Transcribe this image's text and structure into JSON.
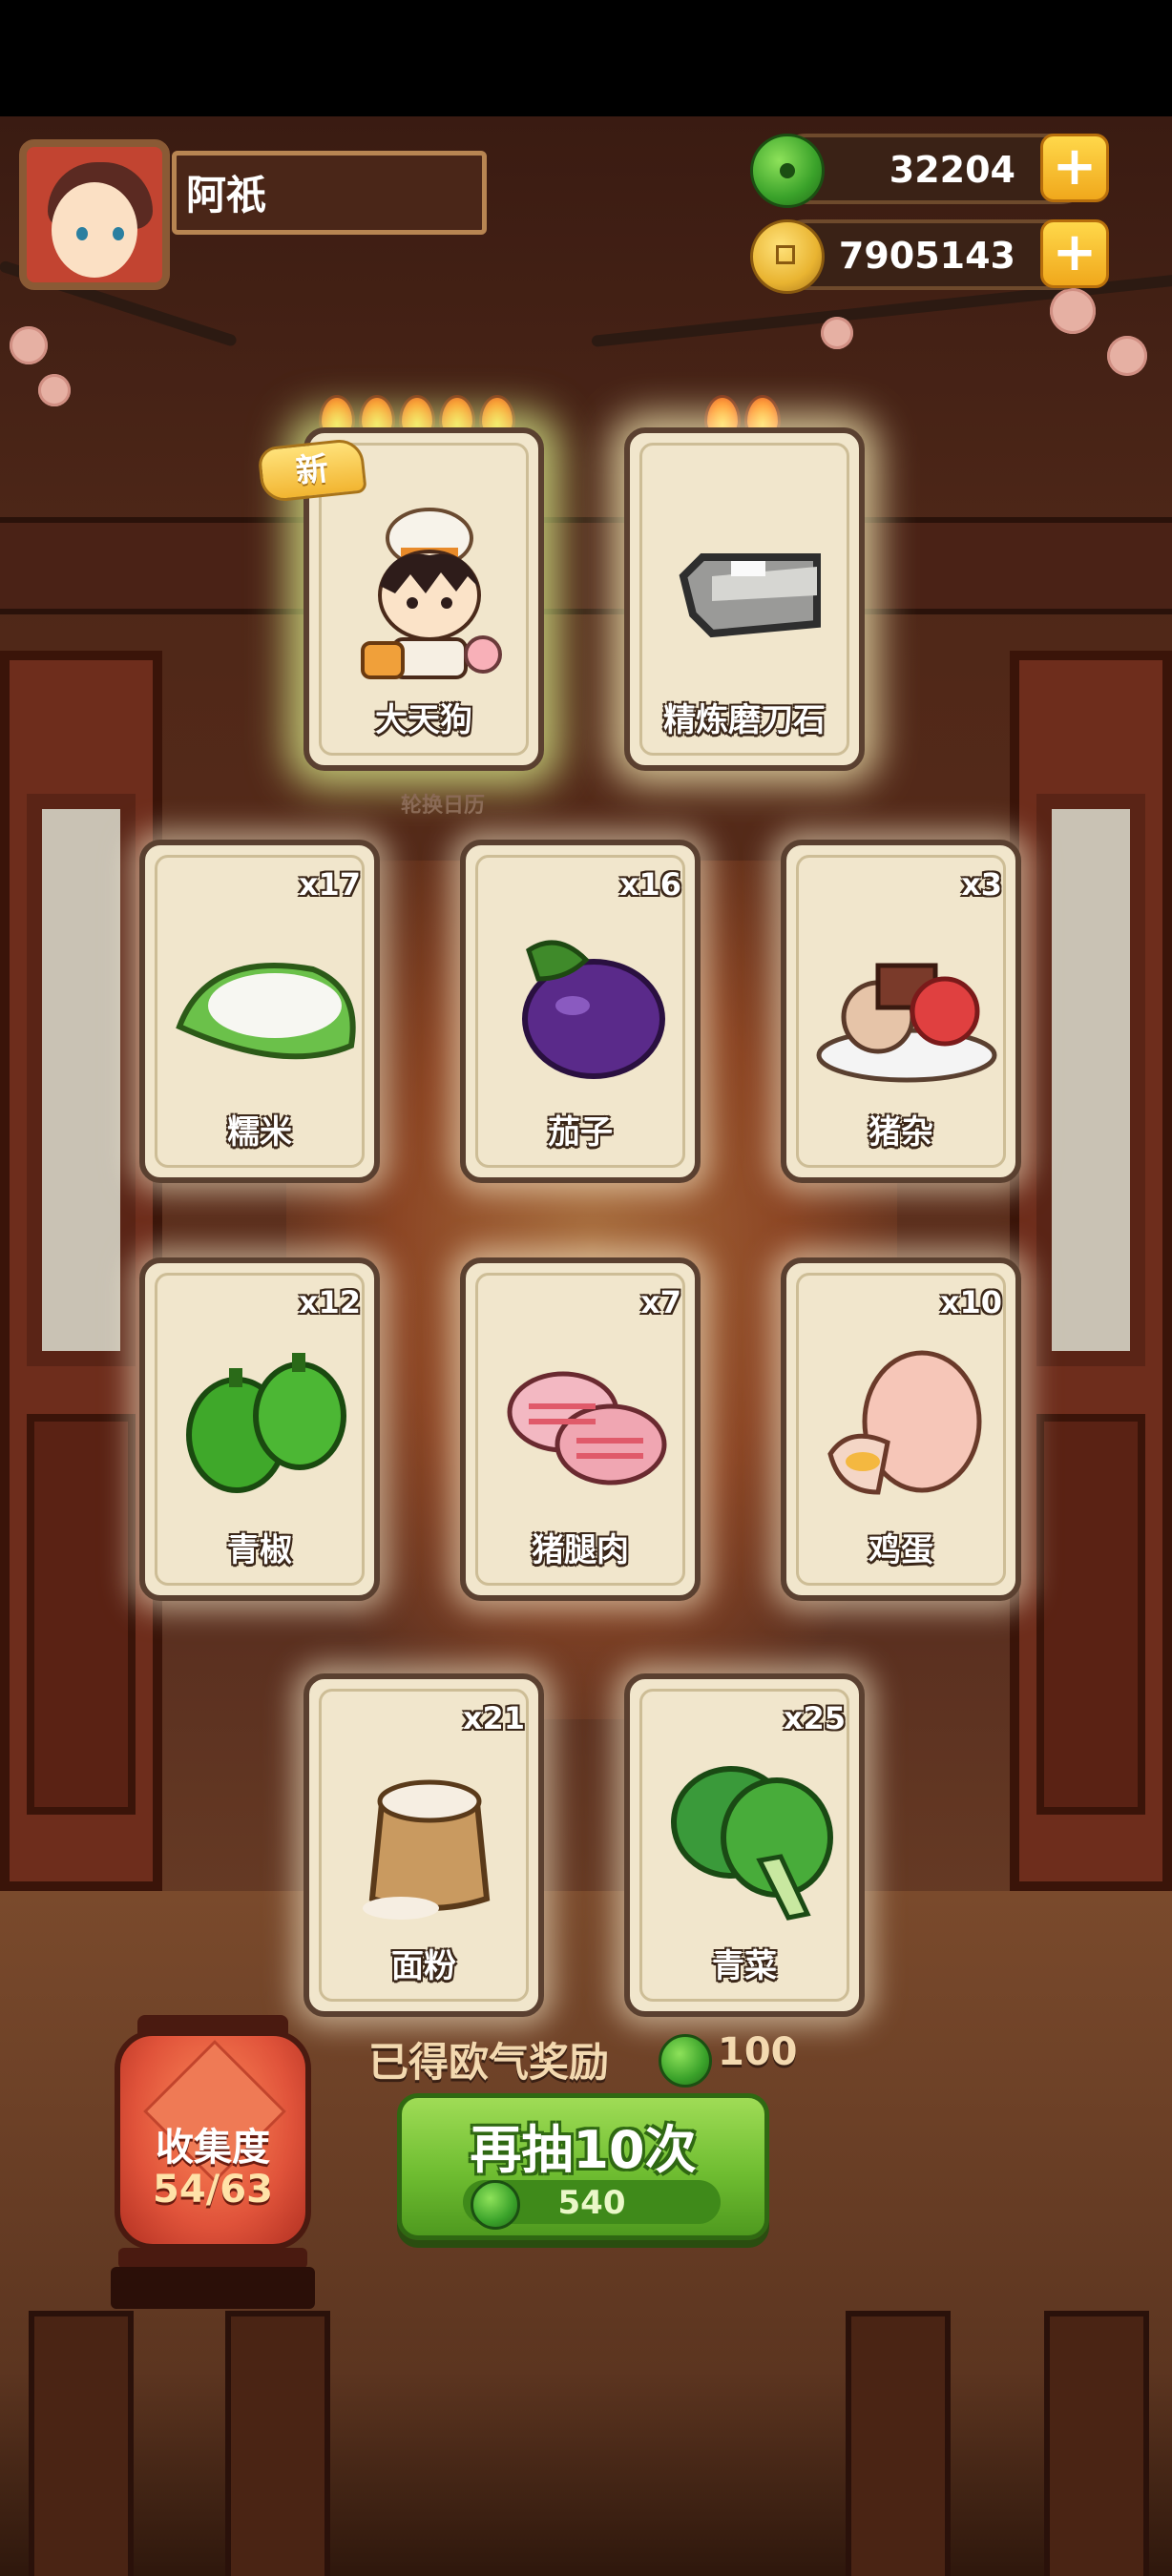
{
  "player": {
    "name": "阿祇"
  },
  "currency": {
    "jade": {
      "value": "32204",
      "icon": "jade-icon"
    },
    "coins": {
      "value": "7905143",
      "icon": "coin-icon"
    }
  },
  "featured": [
    {
      "name": "大天狗",
      "flames": 5,
      "badge": "新"
    },
    {
      "name": "精炼磨刀石",
      "flames": 2
    }
  ],
  "rotation_label": "轮换日历",
  "items": [
    {
      "name": "糯米",
      "count": "x17"
    },
    {
      "name": "茄子",
      "count": "x16"
    },
    {
      "name": "猪杂",
      "count": "x3"
    },
    {
      "name": "青椒",
      "count": "x12"
    },
    {
      "name": "猪腿肉",
      "count": "x7"
    },
    {
      "name": "鸡蛋",
      "count": "x10"
    },
    {
      "name": "面粉",
      "count": "x21"
    },
    {
      "name": "青菜",
      "count": "x25"
    }
  ],
  "reward": {
    "label": "已得欧气奖励",
    "value": "100"
  },
  "draw_button": {
    "label": "再抽10次",
    "cost": "540"
  },
  "collection": {
    "label": "收集度",
    "value": "54/63"
  },
  "colors": {
    "button_green": "#6fbd31",
    "lantern_red": "#e0533a",
    "card_bg": "#f1e6cc"
  }
}
